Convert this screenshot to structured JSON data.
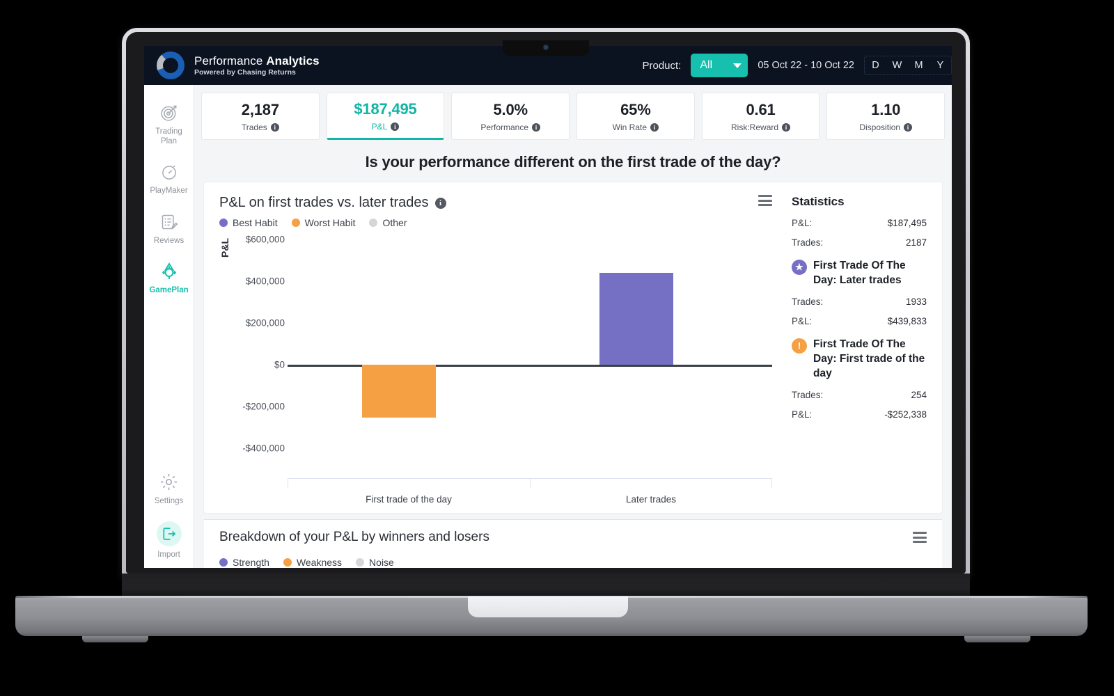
{
  "header": {
    "brand_title_light": "Performance ",
    "brand_title_bold": "Analytics",
    "brand_subtitle": "Powered by Chasing Returns",
    "logo_icon": "donut-logo-icon",
    "product_label": "Product:",
    "product_value": "All",
    "date_range": "05 Oct 22  -  10 Oct 22",
    "period_tabs": [
      "D",
      "W",
      "M",
      "Y"
    ]
  },
  "sidebar": {
    "items": [
      {
        "label": "Trading\nPlan",
        "label_line1": "Trading",
        "label_line2": "Plan",
        "icon": "target-icon",
        "active": false
      },
      {
        "label": "PlayMaker",
        "icon": "stopwatch-icon",
        "active": false
      },
      {
        "label": "Reviews",
        "icon": "notes-pencil-icon",
        "active": false
      },
      {
        "label": "GamePlan",
        "icon": "compass-crosshair-icon",
        "active": true
      },
      {
        "label": "Settings",
        "icon": "gear-icon",
        "active": false
      },
      {
        "label": "Import",
        "icon": "import-arrow-icon",
        "active": false
      }
    ]
  },
  "kpis": [
    {
      "value": "2,187",
      "label": "Trades",
      "selected": false
    },
    {
      "value": "$187,495",
      "label": "P&L",
      "selected": true
    },
    {
      "value": "5.0%",
      "label": "Performance",
      "selected": false
    },
    {
      "value": "65%",
      "label": "Win Rate",
      "selected": false
    },
    {
      "value": "0.61",
      "label": "Risk:Reward",
      "selected": false
    },
    {
      "value": "1.10",
      "label": "Disposition",
      "selected": false
    }
  ],
  "question_banner": "Is your performance different on the first trade of the day?",
  "chart_card": {
    "title": "P&L on first trades vs. later trades",
    "info_icon": "info-icon",
    "menu_icon": "hamburger-menu-icon"
  },
  "statistics": {
    "title": "Statistics",
    "overall": [
      {
        "label": "P&L:",
        "value": "$187,495"
      },
      {
        "label": "Trades:",
        "value": "2187"
      }
    ],
    "groups": [
      {
        "icon": "star-badge-icon",
        "icon_color": "#7570C4",
        "icon_glyph": "★",
        "name": "First Trade Of The Day: Later trades",
        "rows": [
          {
            "label": "Trades:",
            "value": "1933"
          },
          {
            "label": "P&L:",
            "value": "$439,833"
          }
        ]
      },
      {
        "icon": "warning-badge-icon",
        "icon_color": "#F5A042",
        "icon_glyph": "!",
        "name": "First Trade Of The Day: First trade of the day",
        "rows": [
          {
            "label": "Trades:",
            "value": "254"
          },
          {
            "label": "P&L:",
            "value": "-$252,338"
          }
        ]
      }
    ]
  },
  "bottom_section": {
    "title": "Breakdown of your P&L by winners and losers",
    "menu_icon": "hamburger-menu-icon",
    "legend": [
      {
        "label": "Strength",
        "color": "#7570C4"
      },
      {
        "label": "Weakness",
        "color": "#F5A042"
      },
      {
        "label": "Noise",
        "color": "#D4D6DA"
      }
    ]
  },
  "chart_data": {
    "type": "bar",
    "title": "P&L on first trades vs. later trades",
    "xlabel": "",
    "ylabel": "P&L",
    "categories": [
      "First trade of the day",
      "Later trades"
    ],
    "values": [
      -252338,
      439833
    ],
    "bar_colors": [
      "#F5A042",
      "#7570C4"
    ],
    "ylim": [
      -400000,
      600000
    ],
    "yticks": [
      600000,
      400000,
      200000,
      0,
      -200000,
      -400000
    ],
    "ytick_labels": [
      "$600,000",
      "$400,000",
      "$200,000",
      "$0",
      "-$200,000",
      "-$400,000"
    ],
    "grid": false,
    "legend_position": "top-left",
    "legend": [
      {
        "label": "Best Habit",
        "color": "#7570C4"
      },
      {
        "label": "Worst Habit",
        "color": "#F5A042"
      },
      {
        "label": "Other",
        "color": "#D4D6DA"
      }
    ]
  },
  "theme": {
    "accent_teal": "#16bfae",
    "header_bg": "#0b1220",
    "purple": "#7570C4",
    "orange": "#F5A042",
    "grey": "#D4D6DA"
  }
}
